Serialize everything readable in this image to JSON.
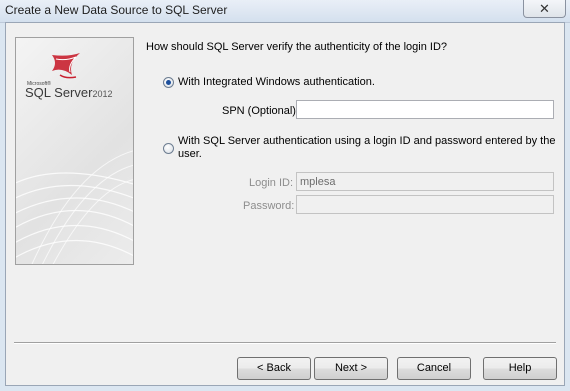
{
  "window": {
    "title": "Create a New Data Source to SQL Server",
    "close_glyph": "✕"
  },
  "logo": {
    "brand_small": "Microsoft®",
    "product": "SQL Server",
    "version": "2012"
  },
  "auth": {
    "question": "How should SQL Server verify the authenticity of the login ID?",
    "option_windows": "With Integrated Windows authentication.",
    "spn_label": "SPN (Optional):",
    "spn_value": "",
    "option_sql": "With SQL Server authentication using a login ID and password entered by the user.",
    "login_label": "Login ID:",
    "login_value": "mplesa",
    "password_label": "Password:",
    "password_value": "",
    "selected": "windows"
  },
  "buttons": {
    "back": "< Back",
    "next": "Next >",
    "cancel": "Cancel",
    "help": "Help"
  },
  "colors": {
    "accent": "#c8202f",
    "radio_dot": "#1c4f9c"
  }
}
